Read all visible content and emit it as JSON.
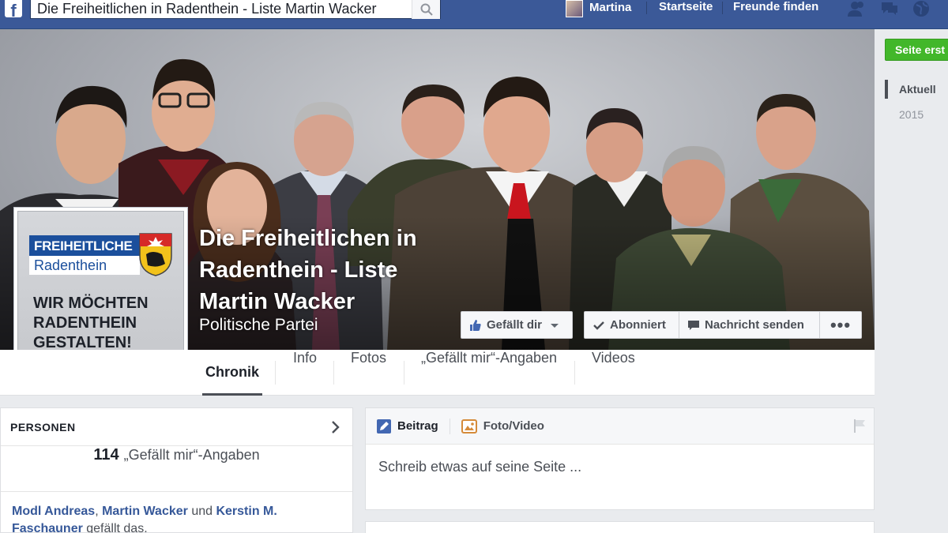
{
  "topbar": {
    "search_value": "Die Freiheitlichen in Radenthein - Liste Martin Wacker",
    "user_name": "Martina",
    "home_label": "Startseite",
    "find_friends_label": "Freunde finden"
  },
  "right_column": {
    "create_page_label": "Seite erst",
    "years": [
      "Aktuell",
      "2015"
    ]
  },
  "page": {
    "title_line1": "Die Freiheitlichen in",
    "title_line2": "Radenthein - Liste",
    "title_line3": "Martin Wacker",
    "category": "Politische Partei"
  },
  "cover_buttons": {
    "like_label": "Gefällt dir",
    "subscribed_label": "Abonniert",
    "message_label": "Nachricht senden",
    "more_label": "•••"
  },
  "profile_picture": {
    "logo_line1": "FREIHEITLICHE",
    "logo_line2": "Radenthein",
    "slogan_line1": "WIR MÖCHTEN",
    "slogan_line2": "RADENTHEIN",
    "slogan_line3": "GESTALTEN!"
  },
  "tabs": [
    {
      "label": "Chronik",
      "active": true
    },
    {
      "label": "Info"
    },
    {
      "label": "Fotos"
    },
    {
      "label": "„Gefällt mir“-Angaben"
    },
    {
      "label": "Videos"
    }
  ],
  "people_card": {
    "title": "PERSONEN",
    "likes_count": "114",
    "likes_label": "„Gefällt mir“-Angaben",
    "friend1": "Modl Andreas",
    "sep1": ", ",
    "friend2": "Martin Wacker",
    "sep2": " und ",
    "friend3": "Kerstin M. Faschauner",
    "suffix": " gefällt das."
  },
  "composer": {
    "tab_post": "Beitrag",
    "tab_photo": "Foto/Video",
    "placeholder": "Schreib etwas auf seine Seite ..."
  },
  "colors": {
    "facebook_blue": "#3b5998",
    "create_green": "#42b72a",
    "link_blue": "#365899"
  }
}
